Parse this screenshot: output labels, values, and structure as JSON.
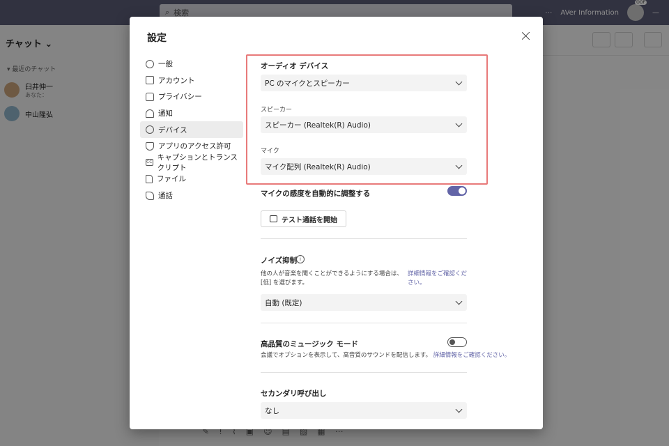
{
  "background": {
    "search_placeholder": "検索",
    "user_name": "AVer Information",
    "avatar_badge": "OOF",
    "left_header": "チャット",
    "recent_label": "最近のチャット",
    "chats": [
      {
        "name": "臼井伸一",
        "sub": "あなた："
      },
      {
        "name": "中山隆弘",
        "sub": ""
      }
    ]
  },
  "dialog": {
    "title": "設定",
    "nav": [
      {
        "label": "一般",
        "icon": "gear-icon"
      },
      {
        "label": "アカウント",
        "icon": "id-card-icon"
      },
      {
        "label": "プライバシー",
        "icon": "lock-icon"
      },
      {
        "label": "通知",
        "icon": "bell-icon"
      },
      {
        "label": "デバイス",
        "icon": "headset-icon"
      },
      {
        "label": "アプリのアクセス許可",
        "icon": "shield-icon"
      },
      {
        "label": "キャプションとトランスクリプト",
        "icon": "cc-icon"
      },
      {
        "label": "ファイル",
        "icon": "file-icon"
      },
      {
        "label": "通話",
        "icon": "phone-icon"
      }
    ],
    "active_nav": "デバイス",
    "audio": {
      "title": "オーディオ デバイス",
      "device_value": "PC のマイクとスピーカー",
      "speaker_label": "スピーカー",
      "speaker_value": "スピーカー (Realtek(R) Audio)",
      "mic_label": "マイク",
      "mic_value": "マイク配列 (Realtek(R) Audio)"
    },
    "auto_adjust_label": "マイクの感度を自動的に調整する",
    "test_call_button": "テスト通話を開始",
    "noise": {
      "title": "ノイズ抑制",
      "desc": "他の人が音楽を聞くことができるようにする場合は、[低] を選びます。",
      "link": "詳細情報をご確認ください。",
      "value": "自動 (既定)"
    },
    "music": {
      "title": "高品質のミュージック モード",
      "desc": "会議でオプションを表示して、高音質のサウンドを配信します。",
      "link": "詳細情報をご確認ください。"
    },
    "secondary": {
      "title": "セカンダリ呼び出し",
      "value": "なし"
    }
  },
  "colors": {
    "accent": "#6264a7",
    "highlight": "#e87a7a",
    "topbar": "#5a5b75"
  }
}
